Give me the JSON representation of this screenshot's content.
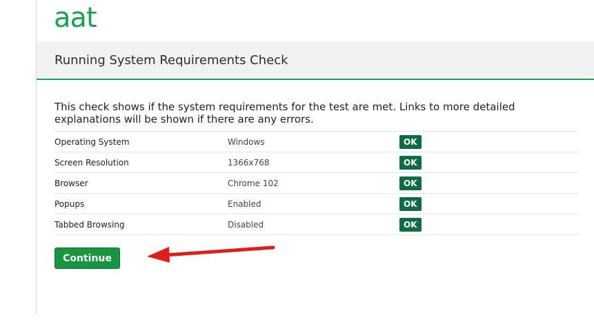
{
  "brand": {
    "logo_text": "aat",
    "accent_color": "#1aa251"
  },
  "header": {
    "title": "Running System Requirements Check"
  },
  "intro": "This check shows if the system requirements for the test are met. Links to more detailed explanations will be shown if there are any errors.",
  "requirements": [
    {
      "name": "Operating System",
      "value": "Windows",
      "status": "OK"
    },
    {
      "name": "Screen Resolution",
      "value": "1366x768",
      "status": "OK"
    },
    {
      "name": "Browser",
      "value": "Chrome 102",
      "status": "OK"
    },
    {
      "name": "Popups",
      "value": "Enabled",
      "status": "OK"
    },
    {
      "name": "Tabbed Browsing",
      "value": "Disabled",
      "status": "OK"
    }
  ],
  "actions": {
    "continue_label": "Continue"
  },
  "annotation": {
    "arrow_color": "#e21b1b"
  }
}
